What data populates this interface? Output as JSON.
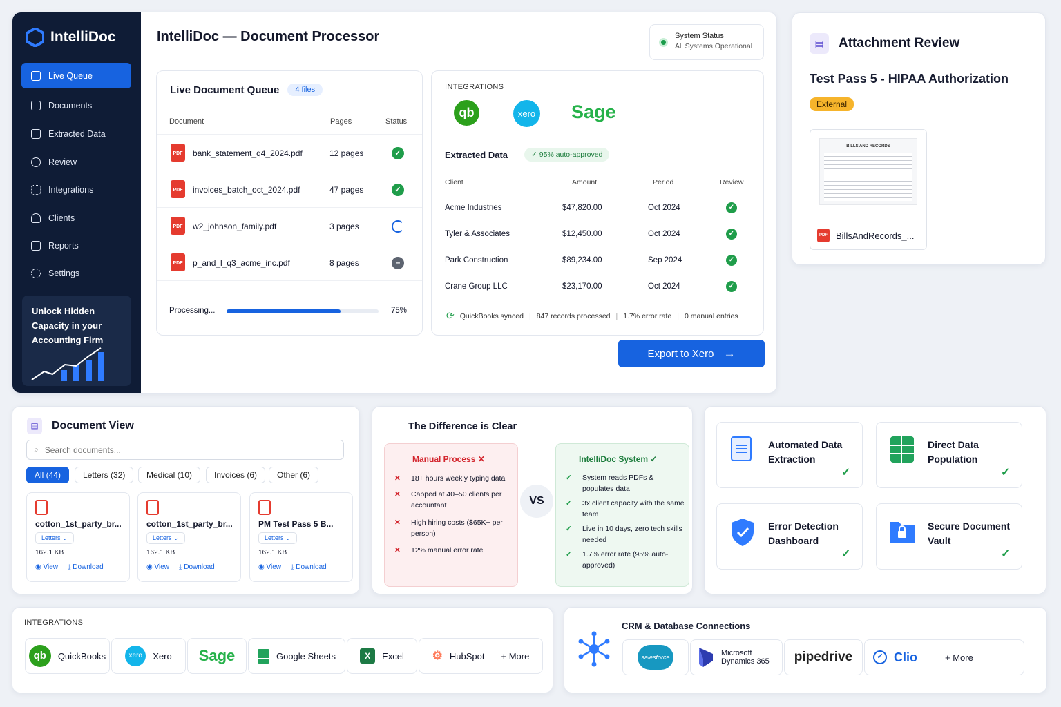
{
  "app": {
    "name": "IntelliDoc",
    "title": "IntelliDoc — Document Processor"
  },
  "sidebar": {
    "items": [
      {
        "label": "Live Queue",
        "icon": "queue-icon"
      },
      {
        "label": "Documents",
        "icon": "document-icon"
      },
      {
        "label": "Extracted Data",
        "icon": "table-icon"
      },
      {
        "label": "Review",
        "icon": "check-icon"
      },
      {
        "label": "Integrations",
        "icon": "integrations-icon"
      },
      {
        "label": "Clients",
        "icon": "clients-icon"
      },
      {
        "label": "Reports",
        "icon": "reports-icon"
      },
      {
        "label": "Settings",
        "icon": "gear-icon"
      }
    ],
    "promo": {
      "text": "Unlock Hidden Capacity in your Accounting Firm"
    }
  },
  "system_status": {
    "title": "System Status",
    "text": "All Systems Operational",
    "color": "#1a9c4a"
  },
  "queue": {
    "title": "Live Document Queue",
    "badge": "4 files",
    "headers": {
      "document": "Document",
      "pages": "Pages",
      "status": "Status"
    },
    "rows": [
      {
        "name": "bank_statement_q4_2024.pdf",
        "pages": "12 pages",
        "status": "done"
      },
      {
        "name": "invoices_batch_oct_2024.pdf",
        "pages": "47 pages",
        "status": "done"
      },
      {
        "name": "w2_johnson_family.pdf",
        "pages": "3 pages",
        "status": "processing"
      },
      {
        "name": "p_and_l_q3_acme_inc.pdf",
        "pages": "8 pages",
        "status": "pending"
      }
    ],
    "progress": {
      "label": "Processing...",
      "value": 0.75,
      "text": "75%"
    },
    "pdf_label": "PDF"
  },
  "integrations_panel": {
    "heading": "INTEGRATIONS",
    "logos": [
      "qb",
      "xero",
      "Sage"
    ],
    "extracted_title": "Extracted Data",
    "approved_badge": "95% auto-approved",
    "headers": {
      "client": "Client",
      "amount": "Amount",
      "period": "Period",
      "review": "Review"
    },
    "rows": [
      {
        "client": "Acme Industries",
        "amount": "$47,820.00",
        "period": "Oct 2024"
      },
      {
        "client": "Tyler & Associates",
        "amount": "$12,450.00",
        "period": "Oct 2024"
      },
      {
        "client": "Park Construction",
        "amount": "$89,234.00",
        "period": "Sep 2024"
      },
      {
        "client": "Crane Group LLC",
        "amount": "$23,170.00",
        "period": "Oct 2024"
      }
    ],
    "footer": {
      "synced": "QuickBooks synced",
      "records": "847 records processed",
      "error": "1.7% error rate",
      "manual": "0 manual entries"
    }
  },
  "export_button": {
    "label": "Export to Xero"
  },
  "attachment_review": {
    "title": "Attachment Review",
    "doc_title": "Test Pass 5 - HIPAA Authorization",
    "badge": "External",
    "badge_color": "#f6b42b",
    "thumb_header": "BILLS AND RECORDS",
    "file_name": "BillsAndRecords_..."
  },
  "document_view": {
    "title": "Document View",
    "search_placeholder": "Search documents...",
    "filters": [
      {
        "label": "All (44)"
      },
      {
        "label": "Letters (32)"
      },
      {
        "label": "Medical (10)"
      },
      {
        "label": "Invoices (6)"
      },
      {
        "label": "Other (6)"
      }
    ],
    "cards": [
      {
        "name": "cotton_1st_party_br...",
        "tag": "Letters",
        "size": "162.1 KB"
      },
      {
        "name": "cotton_1st_party_br...",
        "tag": "Letters",
        "size": "162.1 KB"
      },
      {
        "name": "PM Test Pass 5 B...",
        "tag": "Letters",
        "size": "162.1 KB"
      }
    ],
    "view_label": "View",
    "download_label": "Download"
  },
  "difference": {
    "title": "The Difference is Clear",
    "vs": "VS",
    "manual": {
      "title": "Manual Process",
      "items": [
        "18+ hours weekly typing data",
        "Capped at 40–50 clients per accountant",
        "High hiring costs ($65K+ per person)",
        "12% manual error rate"
      ]
    },
    "intellidoc": {
      "title": "IntelliDoc System",
      "items": [
        "System reads PDFs & populates data",
        "3x client capacity with the same team",
        "Live in 10 days, zero tech skills needed",
        "1.7% error rate (95% auto-approved)"
      ]
    }
  },
  "features": [
    {
      "label": "Automated Data Extraction",
      "icon": "document-sparkle-icon"
    },
    {
      "label": "Direct Data Population",
      "icon": "spreadsheet-icon"
    },
    {
      "label": "Error Detection Dashboard",
      "icon": "shield-check-icon"
    },
    {
      "label": "Secure Document Vault",
      "icon": "folder-lock-icon"
    }
  ],
  "integrations_bar": {
    "heading": "INTEGRATIONS",
    "items": [
      {
        "label": "QuickBooks",
        "icon": "qb"
      },
      {
        "label": "Xero",
        "icon": "xero"
      },
      {
        "label": "Sage",
        "icon": "Sage"
      },
      {
        "label": "Google Sheets",
        "icon": "sheets"
      },
      {
        "label": "Excel",
        "icon": "X"
      },
      {
        "label": "HubSpot",
        "icon": "hubspot"
      }
    ],
    "more": "+ More"
  },
  "crm": {
    "title": "CRM & Database Connections",
    "items": [
      {
        "label": "salesforce"
      },
      {
        "label": "Microsoft Dynamics 365"
      },
      {
        "label": "pipedrive"
      },
      {
        "label": "Clio"
      }
    ],
    "more": "+ More"
  }
}
